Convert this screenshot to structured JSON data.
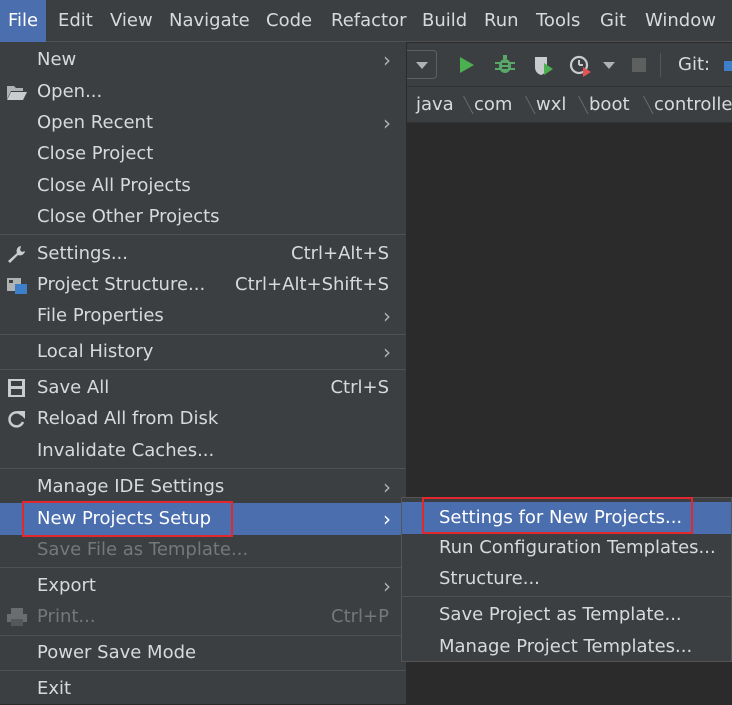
{
  "menubar": {
    "items": [
      "File",
      "Edit",
      "View",
      "Navigate",
      "Code",
      "Refactor",
      "Build",
      "Run",
      "Tools",
      "Git",
      "Window"
    ]
  },
  "toolbar": {
    "git_label": "Git:",
    "icons": [
      "run-icon",
      "debug-icon",
      "coverage-icon",
      "profile-icon",
      "dropdown-icon",
      "stop-icon"
    ]
  },
  "breadcrumb": [
    "java",
    "com",
    "wxl",
    "boot",
    "controlle"
  ],
  "file_menu": {
    "new": "New",
    "open": "Open...",
    "open_recent": "Open Recent",
    "close_project": "Close Project",
    "close_all_projects": "Close All Projects",
    "close_other_projects": "Close Other Projects",
    "settings": "Settings...",
    "settings_shortcut": "Ctrl+Alt+S",
    "project_structure": "Project Structure...",
    "project_structure_shortcut": "Ctrl+Alt+Shift+S",
    "file_properties": "File Properties",
    "local_history": "Local History",
    "save_all": "Save All",
    "save_all_shortcut": "Ctrl+S",
    "reload_all": "Reload All from Disk",
    "invalidate_caches": "Invalidate Caches...",
    "manage_ide_settings": "Manage IDE Settings",
    "new_projects_setup": "New Projects Setup",
    "save_file_as_template": "Save File as Template...",
    "export": "Export",
    "print": "Print...",
    "print_shortcut": "Ctrl+P",
    "power_save_mode": "Power Save Mode",
    "exit": "Exit"
  },
  "submenu": {
    "settings_for_new_projects": "Settings for New Projects...",
    "run_configuration_templates": "Run Configuration Templates...",
    "structure": "Structure...",
    "save_project_as_template": "Save Project as Template...",
    "manage_project_templates": "Manage Project Templates..."
  },
  "colors": {
    "menu_bg": "#3c3f41",
    "editor_bg": "#2b2b2b",
    "highlight": "#4b6eaf",
    "annotation_red": "#e0282e",
    "run_green": "#4caf50"
  }
}
